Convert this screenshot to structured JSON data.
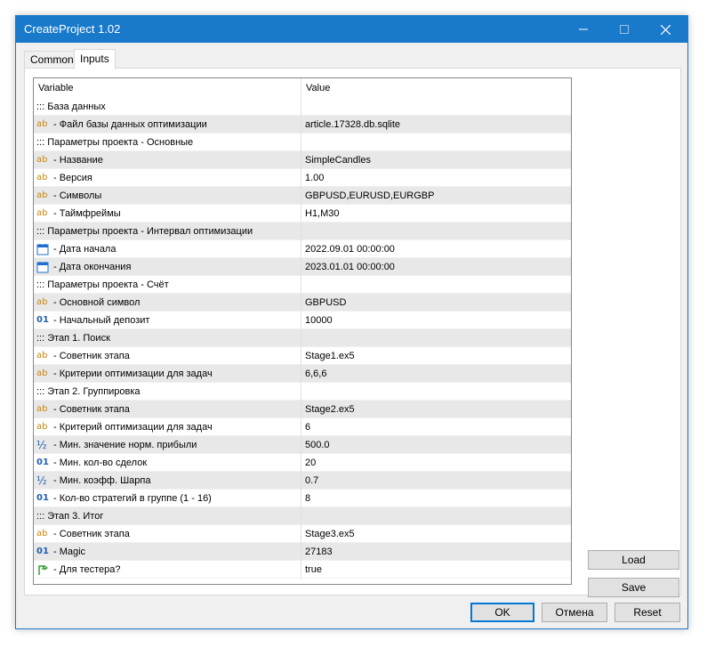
{
  "window": {
    "title": "CreateProject 1.02"
  },
  "tabs": [
    {
      "label": "Common",
      "active": false
    },
    {
      "label": "Inputs",
      "active": true
    }
  ],
  "grid": {
    "columns": [
      "Variable",
      "Value"
    ],
    "rows": [
      {
        "icon": "none",
        "name": "::: База данных",
        "value": ""
      },
      {
        "icon": "ab",
        "name": " - Файл базы данных оптимизации",
        "value": "article.17328.db.sqlite"
      },
      {
        "icon": "none",
        "name": "::: Параметры проекта - Основные",
        "value": ""
      },
      {
        "icon": "ab",
        "name": " - Название",
        "value": "SimpleCandles"
      },
      {
        "icon": "ab",
        "name": " - Версия",
        "value": "1.00"
      },
      {
        "icon": "ab",
        "name": " - Символы",
        "value": "GBPUSD,EURUSD,EURGBP"
      },
      {
        "icon": "ab",
        "name": " - Таймфреймы",
        "value": "H1,M30"
      },
      {
        "icon": "none",
        "name": "::: Параметры проекта - Интервал оптимизации",
        "value": ""
      },
      {
        "icon": "calendar",
        "name": " - Дата начала",
        "value": "2022.09.01 00:00:00"
      },
      {
        "icon": "calendar",
        "name": " - Дата окончания",
        "value": "2023.01.01 00:00:00"
      },
      {
        "icon": "none",
        "name": "::: Параметры проекта - Счёт",
        "value": ""
      },
      {
        "icon": "ab",
        "name": " - Основной символ",
        "value": "GBPUSD"
      },
      {
        "icon": "01",
        "name": " - Начальный депозит",
        "value": "10000"
      },
      {
        "icon": "none",
        "name": "::: Этап 1. Поиск",
        "value": ""
      },
      {
        "icon": "ab",
        "name": " - Советник этапа",
        "value": "Stage1.ex5"
      },
      {
        "icon": "ab",
        "name": " - Критерии оптимизации для задач",
        "value": "6,6,6"
      },
      {
        "icon": "none",
        "name": "::: Этап 2. Группировка",
        "value": ""
      },
      {
        "icon": "ab",
        "name": " - Советник этапа",
        "value": "Stage2.ex5"
      },
      {
        "icon": "ab",
        "name": " - Критерий оптимизации для задач",
        "value": "6"
      },
      {
        "icon": "half",
        "name": " - Мин. значение норм. прибыли",
        "value": "500.0"
      },
      {
        "icon": "01",
        "name": " - Мин. кол-во сделок",
        "value": "20"
      },
      {
        "icon": "half",
        "name": " - Мин. коэфф. Шарпа",
        "value": "0.7"
      },
      {
        "icon": "01",
        "name": " - Кол-во стратегий в группе (1 - 16)",
        "value": "8"
      },
      {
        "icon": "none",
        "name": "::: Этап 3. Итог",
        "value": ""
      },
      {
        "icon": "ab",
        "name": " - Советник этапа",
        "value": "Stage3.ex5"
      },
      {
        "icon": "01",
        "name": " - Magic",
        "value": "27183"
      },
      {
        "icon": "bool",
        "name": " - Для тестера?",
        "value": "true"
      }
    ]
  },
  "buttons": {
    "load": "Load",
    "save": "Save",
    "ok": "OK",
    "cancel": "Отмена",
    "reset": "Reset"
  },
  "colors": {
    "titlebar": "#1979ca",
    "string_icon": "#c8860a",
    "number_icon": "#1f5fb0",
    "bool_icon": "#2e9b2e",
    "calendar_icon": "#1f6fd0"
  }
}
